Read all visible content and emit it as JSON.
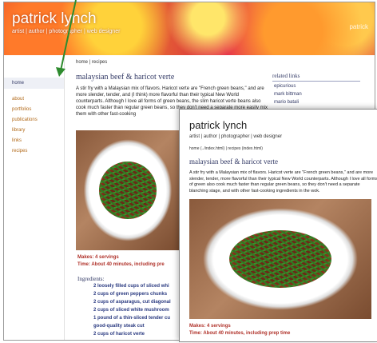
{
  "back_page": {
    "banner": {
      "title": "patrick lynch",
      "subtitle": "artist | author | photographer | web designer",
      "right_text": "patrick"
    },
    "sidebar": {
      "items": [
        {
          "label": "home"
        },
        {
          "label": "about"
        },
        {
          "label": "portfolios"
        },
        {
          "label": "publications"
        },
        {
          "label": "library"
        },
        {
          "label": "links"
        },
        {
          "label": "recipes"
        }
      ]
    },
    "breadcrumb": "home | recipes",
    "heading": "malaysian beef & haricot verte",
    "paragraph": "A stir fry with a Malaysian mix of flavors. Haricot verte are \"French green beans,\" and are more slender, tender, and (I think) more flavorful than their typical New World counterparts. Although I love all forms of green beans, the slim haricot verte beans also cook much faster than regular green beans, so they don't need a separate more easily mix them with other fast-cooking",
    "related": {
      "title": "related links",
      "links": [
        "epicurious",
        "mark bittman",
        "mario batali"
      ]
    },
    "makes": "Makes: 4 servings",
    "time": "Time: About 40 minutes, including pre",
    "ingredients_title": "Ingredients:",
    "ingredients": [
      "2 loosely filled cups of sliced whi",
      "2 cups of green peppers chunks",
      "2 cups of asparagus, cut diagonal",
      "2 cups of sliced white mushroom",
      "1 pound of a thin-sliced tender cu",
      "good-quality steak cut",
      "2 cups of haricot verte"
    ]
  },
  "front_page": {
    "title": "patrick lynch",
    "subtitle": "artist | author | photographer | web designer",
    "breadcrumb": "home (../index.html) | recipes (index.html)",
    "heading": "malaysian beef & haricot verte",
    "paragraph": "A stir fry with a Malaysian mix of flavors. Haricot verte are \"French green beans,\" and are more slender, tender, more flavorful than their typical New World counterparts. Although I love all forms of green also cook much faster than regular green beans, so they don't need a separate blanching stage, and with other fast-cooking ingredients in the wok.",
    "makes": "Makes: 4 servings",
    "time": "Time: About 40 minutes, including prep time"
  },
  "colors": {
    "arrow": "#2e8b2e",
    "heading": "#333a66",
    "nav_link": "#b26a1a",
    "makes": "#b0322a",
    "ingredient": "#2a3a80"
  }
}
